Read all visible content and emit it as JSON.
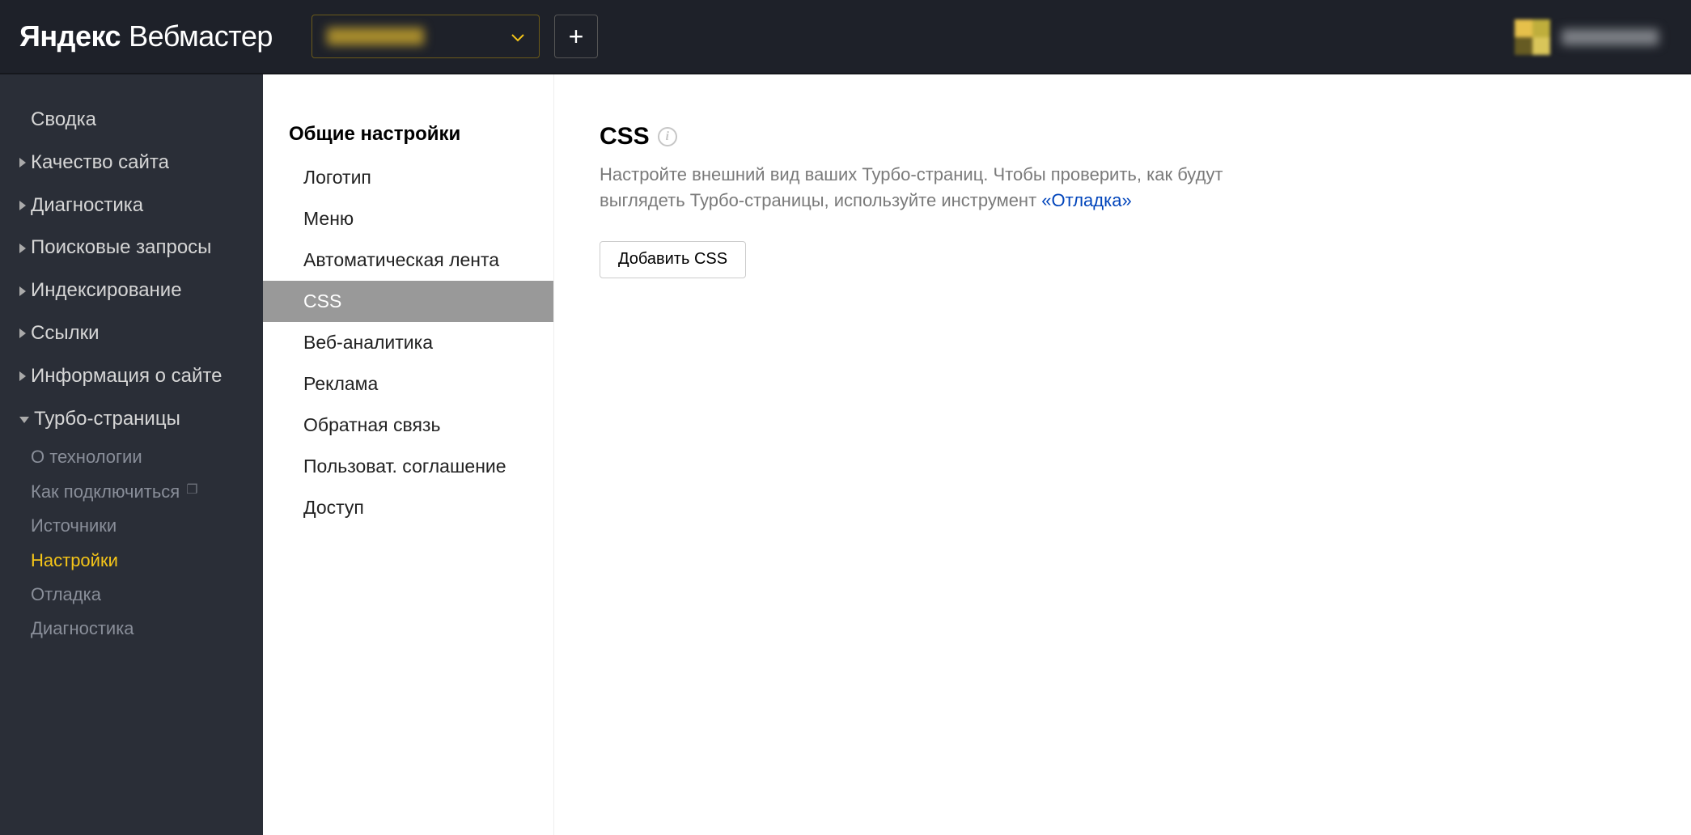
{
  "header": {
    "logo_yandex": "Яндекс",
    "logo_webmaster": "Вебмастер"
  },
  "sidebar": {
    "items": [
      {
        "label": "Сводка",
        "has_caret": false,
        "open": false
      },
      {
        "label": "Качество сайта",
        "has_caret": true,
        "open": false
      },
      {
        "label": "Диагностика",
        "has_caret": true,
        "open": false
      },
      {
        "label": "Поисковые запросы",
        "has_caret": true,
        "open": false
      },
      {
        "label": "Индексирование",
        "has_caret": true,
        "open": false
      },
      {
        "label": "Ссылки",
        "has_caret": true,
        "open": false
      },
      {
        "label": "Информация о сайте",
        "has_caret": true,
        "open": false
      },
      {
        "label": "Турбо-страницы",
        "has_caret": true,
        "open": true
      }
    ],
    "turbo_children": [
      {
        "label": "О технологии",
        "active": false,
        "external": false
      },
      {
        "label": "Как подключиться",
        "active": false,
        "external": true
      },
      {
        "label": "Источники",
        "active": false,
        "external": false
      },
      {
        "label": "Настройки",
        "active": true,
        "external": false
      },
      {
        "label": "Отладка",
        "active": false,
        "external": false
      },
      {
        "label": "Диагностика",
        "active": false,
        "external": false
      }
    ]
  },
  "secondary": {
    "title": "Общие настройки",
    "items": [
      {
        "label": "Логотип",
        "active": false
      },
      {
        "label": "Меню",
        "active": false
      },
      {
        "label": "Автоматическая лента",
        "active": false
      },
      {
        "label": "CSS",
        "active": true
      },
      {
        "label": "Веб-аналитика",
        "active": false
      },
      {
        "label": "Реклама",
        "active": false
      },
      {
        "label": "Обратная связь",
        "active": false
      },
      {
        "label": "Пользоват. соглашение",
        "active": false
      },
      {
        "label": "Доступ",
        "active": false
      }
    ]
  },
  "main": {
    "heading": "CSS",
    "desc_before": "Настройте внешний вид ваших Турбо-страниц. Чтобы проверить, как будут выглядеть Турбо-страницы, используйте инструмент ",
    "desc_link": "«Отладка»",
    "add_button": "Добавить CSS"
  }
}
